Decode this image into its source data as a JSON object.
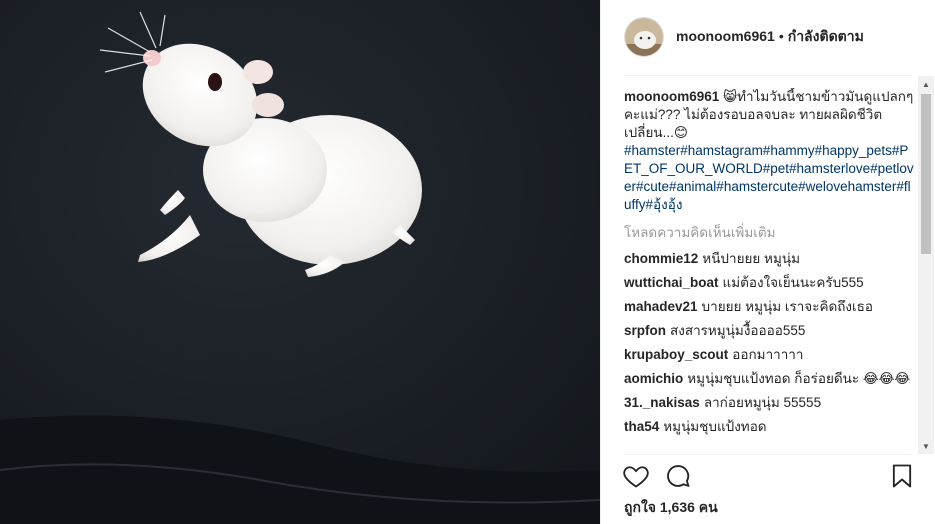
{
  "post": {
    "username": "moonoom6961",
    "separator": "•",
    "follow_status": "กำลังติดตาม"
  },
  "caption": {
    "username": "moonoom6961",
    "text": "😸ทำไมวันนี้ชามข้าวมันดูแปลกๆคะแม่??? ไม่ต้องรอบอลจบละ ทายผลผิดชีวิตเปลี่ยน...😊",
    "hashtags": "#hamster#hamstagram#hammy#happy_pets#PET_OF_OUR_WORLD#pet#hamsterlove#petlover#cute#animal#hamstercute#welovehamster#fluffy#อุ้งอุ้ง"
  },
  "load_more": "โหลดความคิดเห็นเพิ่มเติม",
  "comments": [
    {
      "user": "chommie12",
      "text": "หนีปายยย หมูนุ่ม"
    },
    {
      "user": "wuttichai_boat",
      "text": "แม่ต้องใจเย็นนะครับ555"
    },
    {
      "user": "mahadev21",
      "text": "บายยย หมูนุ่ม เราจะคิดถึงเธอ"
    },
    {
      "user": "srpfon",
      "text": "สงสารหมูนุ่มงื้ออออ555"
    },
    {
      "user": "krupaboy_scout",
      "text": "ออกมาาาาา"
    },
    {
      "user": "aomichio",
      "text": "หมูนุ่มชุบแป้งทอด ก็อร่อยดีนะ 😂😂😂"
    },
    {
      "user": "31._nakisas",
      "text": "ลาก่อยหมูนุ่ม 55555"
    },
    {
      "user": "tha54",
      "text": "หมูนุ่มชุบแป้งทอด"
    }
  ],
  "icons": {
    "like": "heart-icon",
    "comment": "comment-icon",
    "save": "bookmark-icon"
  },
  "likes_text": "ถูกใจ 1,636 คน"
}
